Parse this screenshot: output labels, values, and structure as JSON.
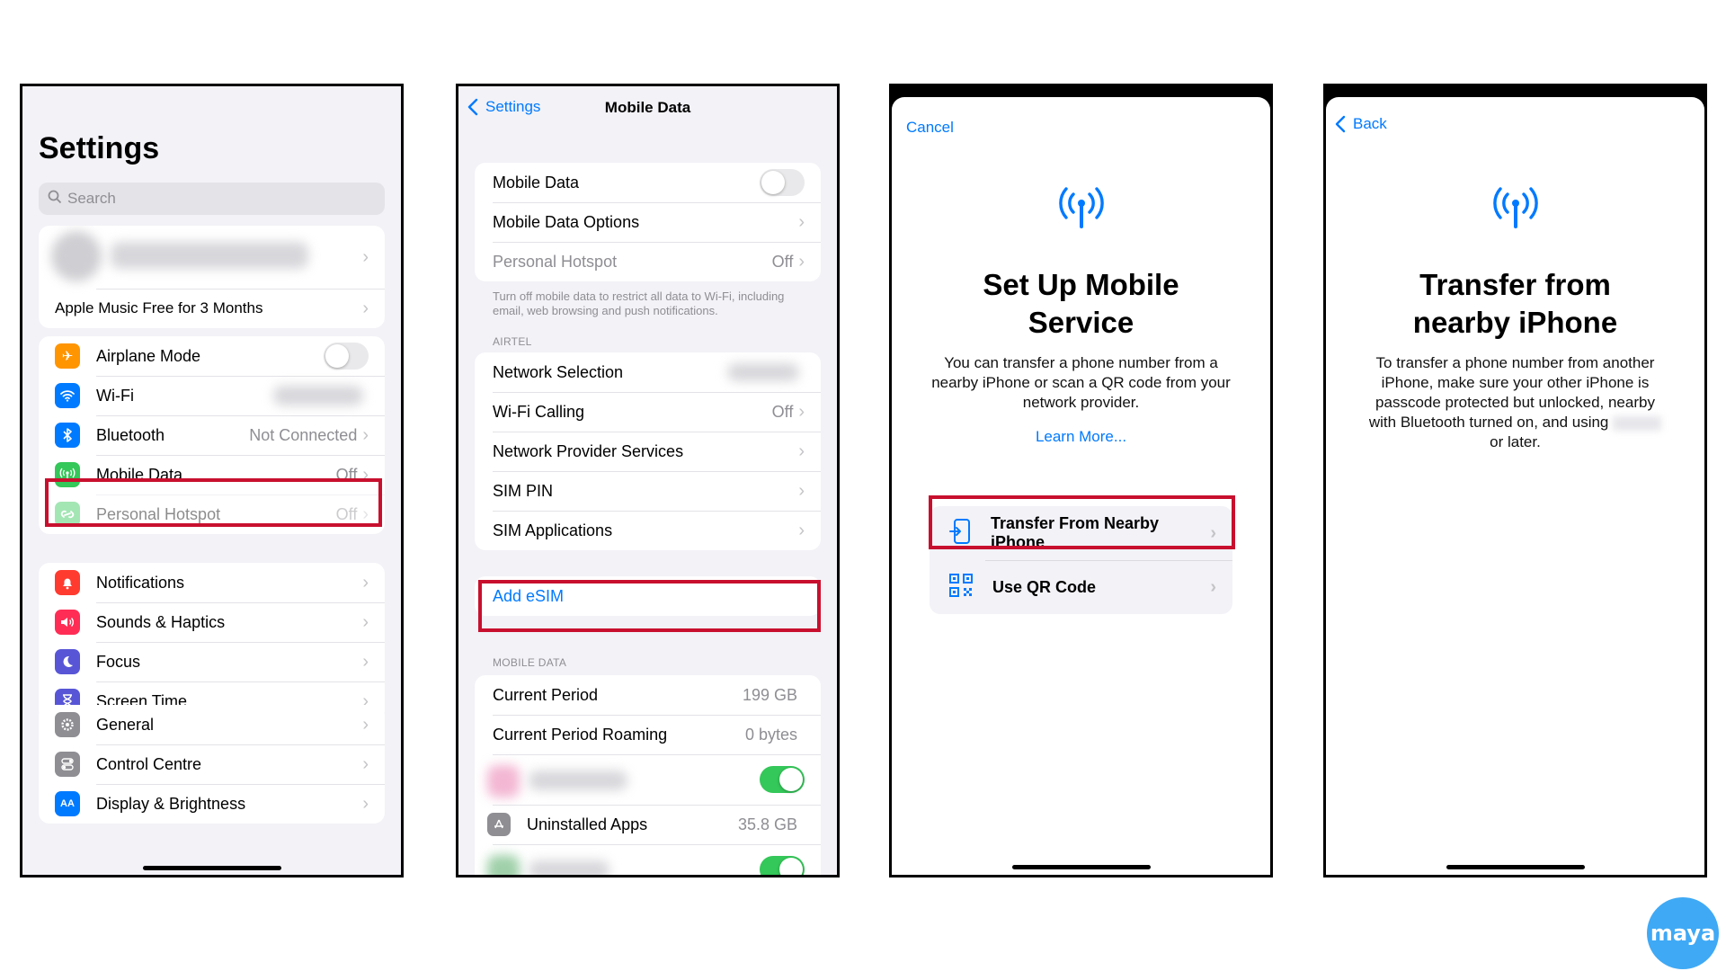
{
  "panel1": {
    "title": "Settings",
    "search_placeholder": "Search",
    "promo": "Apple Music Free for 3 Months",
    "group1": [
      {
        "label": "Airplane Mode",
        "value": "",
        "icon": "airplane-icon",
        "color": "#ff9500"
      },
      {
        "label": "Wi-Fi",
        "value": "",
        "icon": "wifi-icon",
        "color": "#007aff"
      },
      {
        "label": "Bluetooth",
        "value": "Not Connected",
        "icon": "bluetooth-icon",
        "color": "#007aff"
      },
      {
        "label": "Mobile Data",
        "value": "Off",
        "icon": "antenna-icon",
        "color": "#34c759"
      },
      {
        "label": "Personal Hotspot",
        "value": "Off",
        "icon": "hotspot-icon",
        "color": "#34c759"
      }
    ],
    "group2": [
      {
        "label": "Notifications",
        "icon": "bell-icon",
        "color": "#ff3b30"
      },
      {
        "label": "Sounds & Haptics",
        "icon": "speaker-icon",
        "color": "#ff2d55"
      },
      {
        "label": "Focus",
        "icon": "moon-icon",
        "color": "#5856d6"
      },
      {
        "label": "Screen Time",
        "icon": "hourglass-icon",
        "color": "#5856d6"
      }
    ],
    "group3": [
      {
        "label": "General",
        "icon": "gear-icon",
        "color": "#8e8e93"
      },
      {
        "label": "Control Centre",
        "icon": "switches-icon",
        "color": "#8e8e93"
      },
      {
        "label": "Display & Brightness",
        "icon": "aa-icon",
        "color": "#007aff"
      }
    ]
  },
  "panel2": {
    "back_label": "Settings",
    "title": "Mobile Data",
    "rows1": [
      {
        "label": "Mobile Data",
        "value": ""
      },
      {
        "label": "Mobile Data Options",
        "value": ""
      },
      {
        "label": "Personal Hotspot",
        "value": "Off"
      }
    ],
    "footer": "Turn off mobile data to restrict all data to Wi-Fi, including email, web browsing and push notifications.",
    "section_carrier": "AIRTEL",
    "rows2": [
      {
        "label": "Network Selection",
        "value": ""
      },
      {
        "label": "Wi-Fi Calling",
        "value": "Off"
      },
      {
        "label": "Network Provider Services",
        "value": ""
      },
      {
        "label": "SIM PIN",
        "value": ""
      },
      {
        "label": "SIM Applications",
        "value": ""
      }
    ],
    "add_esim": "Add eSIM",
    "section_data": "MOBILE DATA",
    "rows3": [
      {
        "label": "Current Period",
        "value": "199 GB"
      },
      {
        "label": "Current Period Roaming",
        "value": "0 bytes"
      }
    ],
    "uninstalled": {
      "label": "Uninstalled Apps",
      "value": "35.8 GB"
    }
  },
  "panel3": {
    "cancel": "Cancel",
    "title": "Set Up Mobile Service",
    "description": "You can transfer a phone number from a nearby iPhone or scan a QR code from your network provider.",
    "learn_more": "Learn More...",
    "option1": "Transfer From Nearby iPhone",
    "option2": "Use QR Code"
  },
  "panel4": {
    "back": "Back",
    "title": "Transfer from nearby iPhone",
    "description": "To transfer a phone number from another iPhone, make sure your other iPhone is passcode protected but unlocked, nearby with Bluetooth turned on, and using",
    "description_end": "or later."
  },
  "brand": {
    "logo_text": "maya",
    "color": "#3fa9f5"
  },
  "colors": {
    "ios_blue": "#007aff",
    "highlight_red": "#c8102e",
    "toggle_green": "#34c759"
  }
}
